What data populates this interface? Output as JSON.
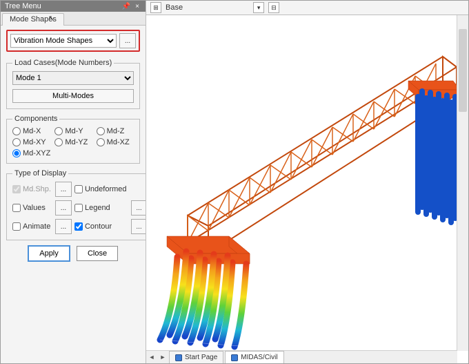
{
  "tree_title": "Tree Menu",
  "tree_pin": "📌",
  "tree_close": "×",
  "tab_label": "Mode Shapes",
  "main_select": "Vibration Mode Shapes",
  "ellipsis": "...",
  "loadcases": {
    "legend": "Load Cases(Mode Numbers)",
    "mode": "Mode 1",
    "multi": "Multi-Modes"
  },
  "components": {
    "legend": "Components",
    "mdx": "Md-X",
    "mdy": "Md-Y",
    "mdz": "Md-Z",
    "mdxy": "Md-XY",
    "mdyz": "Md-YZ",
    "mdxz": "Md-XZ",
    "mdxyz": "Md-XYZ"
  },
  "display": {
    "legend": "Type of Display",
    "mdshp": "Md.Shp.",
    "undeformed": "Undeformed",
    "values": "Values",
    "legend_cb": "Legend",
    "animate": "Animate",
    "contour": "Contour"
  },
  "apply": "Apply",
  "close": "Close",
  "toolbar": {
    "base": "Base"
  },
  "tabs": {
    "start": "Start Page",
    "current": "MIDAS/Civil"
  }
}
